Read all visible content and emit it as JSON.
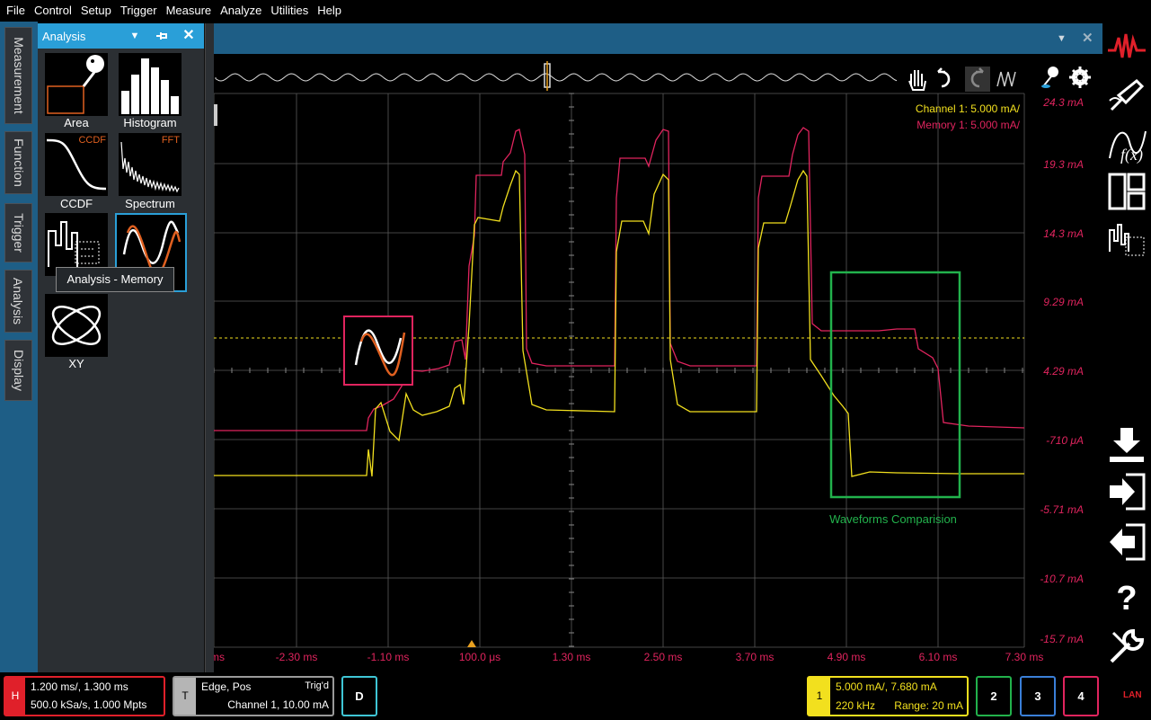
{
  "menu": [
    "File",
    "Control",
    "Setup",
    "Trigger",
    "Measure",
    "Analyze",
    "Utilities",
    "Help"
  ],
  "left_tabs": [
    "Measurement",
    "Function",
    "Trigger",
    "Analysis",
    "Display"
  ],
  "panel": {
    "title": "Analysis",
    "tiles": [
      {
        "label": "Area",
        "icon": "area-icon"
      },
      {
        "label": "Histogram",
        "icon": "histogram-icon"
      },
      {
        "label": "CCDF",
        "icon": "ccdf-icon",
        "tag": "CCDF"
      },
      {
        "label": "Spectrum",
        "icon": "spectrum-icon",
        "tag": "FFT"
      },
      {
        "label": "",
        "icon": "analysis-digital-icon"
      },
      {
        "label": "",
        "icon": "memory-icon",
        "selected": true
      },
      {
        "label": "XY",
        "icon": "xy-icon"
      }
    ],
    "tooltip": "Analysis - Memory"
  },
  "scope": {
    "legend": {
      "ch1": "Channel 1:  5.000 mA/",
      "mem1": "Memory 1:  5.000 mA/"
    },
    "y_ticks": [
      "24.3 mA",
      "19.3 mA",
      "14.3 mA",
      "9.29 mA",
      "4.29 mA",
      "-710 μA",
      "-5.71 mA",
      "-10.7 mA",
      "-15.7 mA"
    ],
    "x_ticks": [
      "ms",
      "-2.30 ms",
      "-1.10 ms",
      "100.0 μs",
      "1.30 ms",
      "2.50 ms",
      "3.70 ms",
      "4.90 ms",
      "6.10 ms",
      "7.30 ms"
    ],
    "annotation": "Waveforms Comparision",
    "colors": {
      "ch1": "#f2e01e",
      "mem1": "#e0245e",
      "grid": "#5a5a5a",
      "axis_label": "#e0245e",
      "annotation": "#22b24c"
    }
  },
  "status": {
    "horizontal": {
      "badge": "H",
      "line1": "1.200 ms/, 1.300 ms",
      "line2": "500.0 kSa/s, 1.000 Mpts"
    },
    "trigger": {
      "badge": "T",
      "line1": "Edge, Pos",
      "state": "Trig'd",
      "line2": "Channel 1, 10.00 mA"
    },
    "digital": "D",
    "channel1": {
      "badge": "1",
      "line1": "5.000 mA/, 7.680 mA",
      "bw": "220 kHz",
      "range": "Range: 20 mA"
    },
    "channels": [
      "2",
      "3",
      "4"
    ],
    "lan": "LAN"
  }
}
